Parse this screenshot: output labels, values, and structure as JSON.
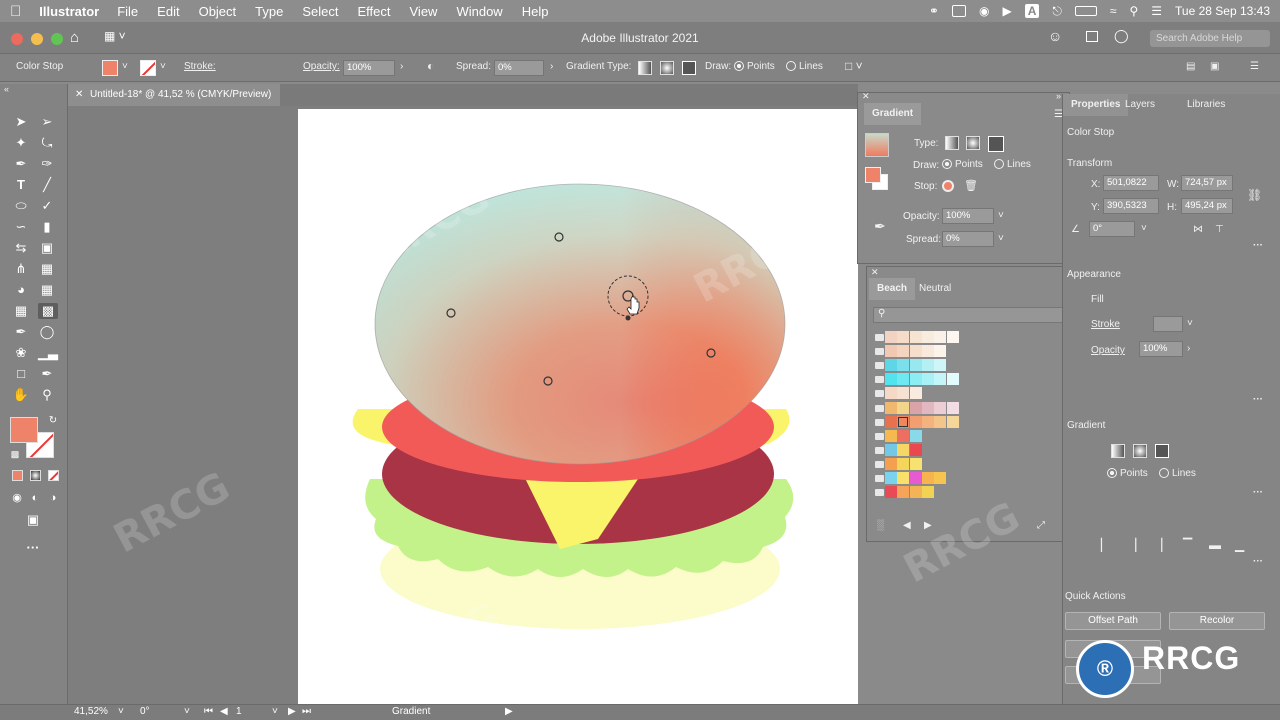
{
  "menubar": {
    "app_name": "Illustrator",
    "items": [
      "File",
      "Edit",
      "Object",
      "Type",
      "Select",
      "Effect",
      "View",
      "Window",
      "Help"
    ],
    "datetime": "Tue 28 Sep  13:43"
  },
  "window": {
    "title": "Adobe Illustrator 2021",
    "search_placeholder": "Search Adobe Help"
  },
  "controlbar": {
    "selection_label": "Color Stop",
    "stroke_label": "Stroke:",
    "opacity_label": "Opacity:",
    "opacity_value": "100%",
    "spread_label": "Spread:",
    "spread_value": "0%",
    "gradient_type_label": "Gradient Type:",
    "draw_label": "Draw:",
    "points_label": "Points",
    "lines_label": "Lines"
  },
  "document": {
    "tab_title": "Untitled-18* @ 41,52 % (CMYK/Preview)"
  },
  "gradient_panel": {
    "title": "Gradient",
    "type_label": "Type:",
    "draw_label": "Draw:",
    "points_label": "Points",
    "lines_label": "Lines",
    "stop_label": "Stop:",
    "opacity_label": "Opacity:",
    "opacity_value": "100%",
    "spread_label": "Spread:",
    "spread_value": "0%"
  },
  "swatches_panel": {
    "tabs": [
      "Beach",
      "Neutral"
    ],
    "rows": [
      [
        "#f2d3c3",
        "#f4dcc8",
        "#f6e4d2",
        "#f8ecde",
        "#faf2e8",
        "#fdf7f0"
      ],
      [
        "#f1c9b2",
        "#f4d4bf",
        "#f6decd",
        "#f9e9dc",
        "#fcf3ea"
      ],
      [
        "#5fd6e6",
        "#7ce0ec",
        "#98e8f0",
        "#b4eff4",
        "#d0f5f8"
      ],
      [
        "#52e4ee",
        "#6ee9f1",
        "#8beef4",
        "#a7f2f6",
        "#c4f6f9",
        "#e2fbfc"
      ],
      [
        "#f3d9c6",
        "#f6e2d3",
        "#f9ebe0"
      ],
      [
        "#f0b86e",
        "#f0d58a",
        "#d9a3a8",
        "#e2b8c0",
        "#eccdd6",
        "#f3dde4"
      ],
      [
        "#e8724f",
        "#ee8760",
        "#f19e70",
        "#f4b27f",
        "#f4c58a",
        "#f5d598"
      ],
      [
        "#f5b94f",
        "#ed6f62",
        "#8ad9e9"
      ],
      [
        "#73c8e6",
        "#f6d765",
        "#e8484e"
      ],
      [
        "#f4a04f",
        "#f5d65a",
        "#f6e171"
      ],
      [
        "#7ad3ec",
        "#f8e06a",
        "#e85ad1",
        "#f7b34e",
        "#f6c44f"
      ],
      [
        "#e84b55",
        "#f6a459",
        "#f3b457",
        "#f2d252"
      ]
    ]
  },
  "properties_panel": {
    "tabs": [
      "Properties",
      "Layers",
      "Libraries"
    ],
    "selection_label": "Color Stop",
    "transform_label": "Transform",
    "x_label": "X:",
    "x_value": "501,0822",
    "y_label": "Y:",
    "y_value": "390,5323",
    "w_label": "W:",
    "w_value": "724,57 px",
    "h_label": "H:",
    "h_value": "495,24 px",
    "angle_value": "0°",
    "appearance_label": "Appearance",
    "fill_label": "Fill",
    "stroke_label": "Stroke",
    "opacity_label": "Opacity",
    "opacity_value": "100%",
    "gradient_label": "Gradient",
    "points_label": "Points",
    "lines_label": "Lines",
    "quick_actions_label": "Quick Actions",
    "offset_path_label": "Offset Path",
    "recolor_label": "Recolor"
  },
  "statusbar": {
    "zoom": "41,52%",
    "angle": "0°",
    "artboard_number": "1",
    "tool_name": "Gradient"
  },
  "watermark_text": "RRCG",
  "colors": {
    "fill_swatch": "#ee836a",
    "bun_top_a": "#bfe3da",
    "bun_top_b": "#f06b4f",
    "cheese": "#f9f46a",
    "patty": "#a83446",
    "lettuce": "#c3f28a",
    "bun_bottom": "#fbfcc9",
    "tomato": "#f25a58"
  }
}
